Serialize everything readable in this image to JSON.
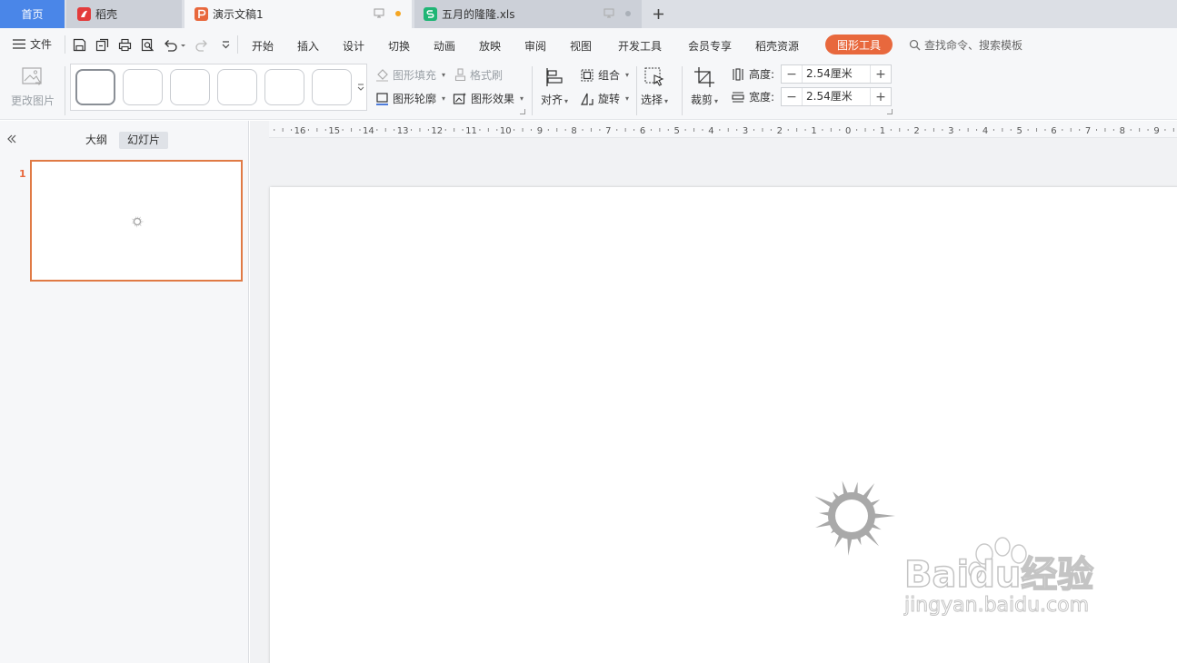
{
  "tabs": [
    {
      "label": "首页"
    },
    {
      "label": "稻壳"
    },
    {
      "label": "演示文稿1"
    },
    {
      "label": "五月的隆隆.xls"
    }
  ],
  "colors": {
    "accent": "#e8683d",
    "home_tab": "#4a86e8",
    "unsaved_dot": "#f5a623",
    "spreadsheet": "#1fb575",
    "daoke": "#e33b3b",
    "shape": "#a9a9a9"
  },
  "menu": {
    "file": "文件",
    "items": [
      "开始",
      "插入",
      "设计",
      "切换",
      "动画",
      "放映",
      "审阅",
      "视图",
      "开发工具",
      "会员专享",
      "稻壳资源"
    ],
    "active": "图形工具",
    "search": "查找命令、搜索模板"
  },
  "ribbon": {
    "change_picture": "更改图片",
    "fill": "图形填充",
    "format_painter": "格式刷",
    "outline": "图形轮廓",
    "effects": "图形效果",
    "align": "对齐",
    "group": "组合",
    "rotate": "旋转",
    "select": "选择",
    "crop": "裁剪",
    "height_label": "高度:",
    "height_value": "2.54厘米",
    "width_label": "宽度:",
    "width_value": "2.54厘米"
  },
  "panel": {
    "outline_tab": "大纲",
    "slides_tab": "幻灯片",
    "slide_number": "1"
  },
  "ruler": {
    "labels": [
      "16",
      "15",
      "14",
      "13",
      "12",
      "11",
      "10",
      "9",
      "8",
      "7",
      "6",
      "5",
      "4",
      "3",
      "2",
      "1",
      "0",
      "1",
      "2",
      "3",
      "4",
      "5",
      "6",
      "7",
      "8",
      "9"
    ]
  },
  "watermark": {
    "text": "Baidu经验",
    "url": "jingyan.baidu.com"
  }
}
